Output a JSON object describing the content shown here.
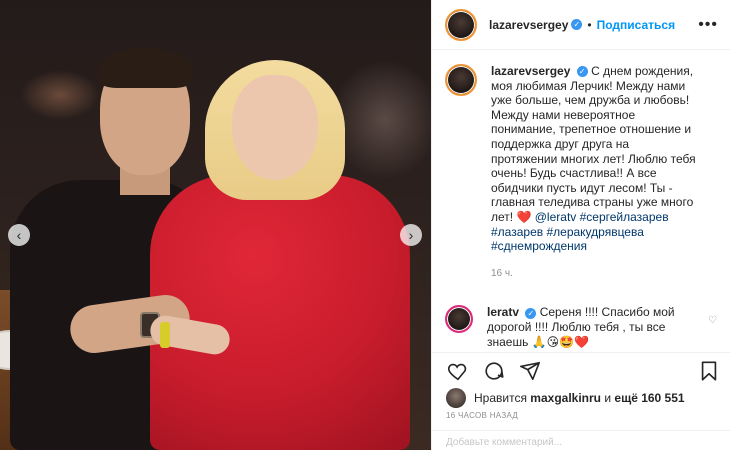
{
  "post": {
    "header": {
      "username": "lazarevsergey",
      "separator": "•",
      "follow_label": "Подписаться",
      "more_label": "•••"
    },
    "caption": {
      "username": "lazarevsergey",
      "text": "С днем рождения, моя любимая Лерчик! Между нами уже больше, чем дружба и любовь! Между нами невероятное понимание, трепетное отношение и поддержка друг друга на протяжении многих лет! Люблю тебя очень! Будь счастлива!! А все обидчики пусть идут лесом! Ты - главная теледива страны уже много лет!",
      "heart": "❤️",
      "mention": "@leratv",
      "hashtags": [
        "#сергейлазарев",
        "#лазарев",
        "#леракудрявцева",
        "#сднемрождения"
      ],
      "time": "16 ч."
    },
    "reply": {
      "username": "leratv",
      "text": "Сереня !!!! Спасибо мой дорогой !!!! Люблю тебя , ты все знаешь",
      "emojis": [
        "🙏",
        "😘",
        "🤩",
        "❤️"
      ]
    },
    "likes": {
      "prefix": "Нравится",
      "user": "maxgalkinru",
      "middle": "и",
      "rest": "ещё 160 551"
    },
    "date": "16 ЧАСОВ НАЗАД",
    "add_comment_placeholder": "Добавьте комментарий..."
  },
  "nav": {
    "prev": "‹",
    "next": "›"
  },
  "colors": {
    "accent": "#0095f6",
    "verified": "#3897f0",
    "heart": "#ed4956"
  },
  "icons": [
    "heart-icon",
    "comment-icon",
    "share-icon",
    "bookmark-icon",
    "verified-icon"
  ]
}
